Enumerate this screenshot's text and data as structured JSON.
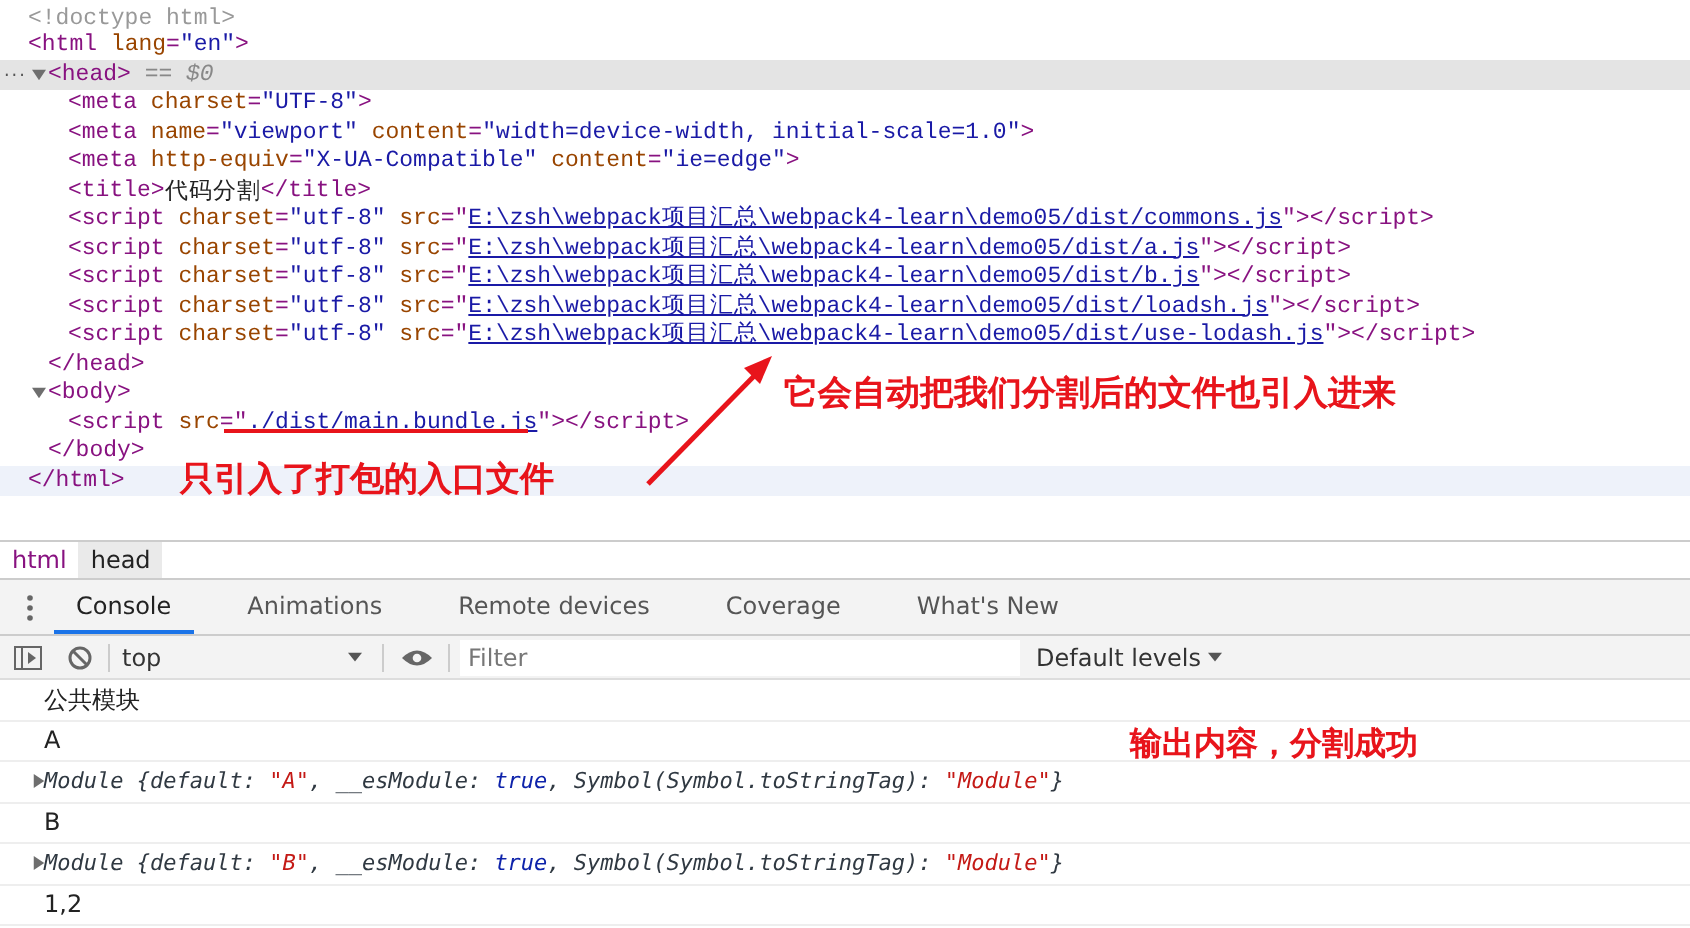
{
  "elements": {
    "doctype": "<!doctype html>",
    "rows": [
      {
        "selected": false,
        "hovered": false,
        "tokens": [
          {
            "kind": "tag",
            "text": "<html"
          },
          {
            "kind": "attr",
            "text": " lang"
          },
          {
            "kind": "tag",
            "text": "="
          },
          {
            "kind": "value",
            "text": "\"en\""
          },
          {
            "kind": "tag",
            "text": ">"
          }
        ],
        "children": [
          {
            "selected": true,
            "hovered": false,
            "expanded": true,
            "gutter": "...",
            "tokens": [
              {
                "kind": "tag",
                "text": "<head>"
              },
              {
                "kind": "marker",
                "text": " == $0"
              }
            ],
            "children": [
              {
                "selected": false,
                "hovered": false,
                "tokens": [
                  {
                    "kind": "tag",
                    "text": "<meta"
                  },
                  {
                    "kind": "attr",
                    "text": " charset"
                  },
                  {
                    "kind": "tag",
                    "text": "="
                  },
                  {
                    "kind": "value",
                    "text": "\"UTF-8\""
                  },
                  {
                    "kind": "tag",
                    "text": ">"
                  }
                ]
              },
              {
                "selected": false,
                "hovered": false,
                "tokens": [
                  {
                    "kind": "tag",
                    "text": "<meta"
                  },
                  {
                    "kind": "attr",
                    "text": " name"
                  },
                  {
                    "kind": "tag",
                    "text": "="
                  },
                  {
                    "kind": "value",
                    "text": "\"viewport\""
                  },
                  {
                    "kind": "attr",
                    "text": " content"
                  },
                  {
                    "kind": "tag",
                    "text": "="
                  },
                  {
                    "kind": "value",
                    "text": "\"width=device-width, initial-scale=1.0\""
                  },
                  {
                    "kind": "tag",
                    "text": ">"
                  }
                ]
              },
              {
                "selected": false,
                "hovered": false,
                "tokens": [
                  {
                    "kind": "tag",
                    "text": "<meta"
                  },
                  {
                    "kind": "attr",
                    "text": " http-equiv"
                  },
                  {
                    "kind": "tag",
                    "text": "="
                  },
                  {
                    "kind": "value",
                    "text": "\"X-UA-Compatible\""
                  },
                  {
                    "kind": "attr",
                    "text": " content"
                  },
                  {
                    "kind": "tag",
                    "text": "="
                  },
                  {
                    "kind": "value",
                    "text": "\"ie=edge\""
                  },
                  {
                    "kind": "tag",
                    "text": ">"
                  }
                ]
              },
              {
                "selected": false,
                "hovered": false,
                "tokens": [
                  {
                    "kind": "tag",
                    "text": "<title>"
                  },
                  {
                    "kind": "text",
                    "text": "代码分割"
                  },
                  {
                    "kind": "tag",
                    "text": "</title>"
                  }
                ]
              },
              {
                "selected": false,
                "hovered": false,
                "tokens": [
                  {
                    "kind": "tag",
                    "text": "<script"
                  },
                  {
                    "kind": "attr",
                    "text": " charset"
                  },
                  {
                    "kind": "tag",
                    "text": "="
                  },
                  {
                    "kind": "value",
                    "text": "\"utf-8\""
                  },
                  {
                    "kind": "attr",
                    "text": " src"
                  },
                  {
                    "kind": "tag",
                    "text": "=\""
                  },
                  {
                    "kind": "link",
                    "text": "E:\\zsh\\webpack项目汇总\\webpack4-learn\\demo05/dist/commons.js"
                  },
                  {
                    "kind": "tag",
                    "text": "\"></script>"
                  }
                ]
              },
              {
                "selected": false,
                "hovered": false,
                "tokens": [
                  {
                    "kind": "tag",
                    "text": "<script"
                  },
                  {
                    "kind": "attr",
                    "text": " charset"
                  },
                  {
                    "kind": "tag",
                    "text": "="
                  },
                  {
                    "kind": "value",
                    "text": "\"utf-8\""
                  },
                  {
                    "kind": "attr",
                    "text": " src"
                  },
                  {
                    "kind": "tag",
                    "text": "=\""
                  },
                  {
                    "kind": "link",
                    "text": "E:\\zsh\\webpack项目汇总\\webpack4-learn\\demo05/dist/a.js"
                  },
                  {
                    "kind": "tag",
                    "text": "\"></script>"
                  }
                ]
              },
              {
                "selected": false,
                "hovered": false,
                "tokens": [
                  {
                    "kind": "tag",
                    "text": "<script"
                  },
                  {
                    "kind": "attr",
                    "text": " charset"
                  },
                  {
                    "kind": "tag",
                    "text": "="
                  },
                  {
                    "kind": "value",
                    "text": "\"utf-8\""
                  },
                  {
                    "kind": "attr",
                    "text": " src"
                  },
                  {
                    "kind": "tag",
                    "text": "=\""
                  },
                  {
                    "kind": "link",
                    "text": "E:\\zsh\\webpack项目汇总\\webpack4-learn\\demo05/dist/b.js"
                  },
                  {
                    "kind": "tag",
                    "text": "\"></script>"
                  }
                ]
              },
              {
                "selected": false,
                "hovered": false,
                "tokens": [
                  {
                    "kind": "tag",
                    "text": "<script"
                  },
                  {
                    "kind": "attr",
                    "text": " charset"
                  },
                  {
                    "kind": "tag",
                    "text": "="
                  },
                  {
                    "kind": "value",
                    "text": "\"utf-8\""
                  },
                  {
                    "kind": "attr",
                    "text": " src"
                  },
                  {
                    "kind": "tag",
                    "text": "=\""
                  },
                  {
                    "kind": "link",
                    "text": "E:\\zsh\\webpack项目汇总\\webpack4-learn\\demo05/dist/loadsh.js"
                  },
                  {
                    "kind": "tag",
                    "text": "\"></script>"
                  }
                ]
              },
              {
                "selected": false,
                "hovered": false,
                "tokens": [
                  {
                    "kind": "tag",
                    "text": "<script"
                  },
                  {
                    "kind": "attr",
                    "text": " charset"
                  },
                  {
                    "kind": "tag",
                    "text": "="
                  },
                  {
                    "kind": "value",
                    "text": "\"utf-8\""
                  },
                  {
                    "kind": "attr",
                    "text": " src"
                  },
                  {
                    "kind": "tag",
                    "text": "=\""
                  },
                  {
                    "kind": "link",
                    "text": "E:\\zsh\\webpack项目汇总\\webpack4-learn\\demo05/dist/use-lodash.js"
                  },
                  {
                    "kind": "tag",
                    "text": "\"></script>"
                  }
                ]
              }
            ]
          },
          {
            "selected": false,
            "hovered": false,
            "tokens": [
              {
                "kind": "tag",
                "text": "</head>"
              }
            ]
          },
          {
            "selected": false,
            "hovered": false,
            "expanded": true,
            "tokens": [
              {
                "kind": "tag",
                "text": "<body>"
              }
            ],
            "children": [
              {
                "selected": false,
                "hovered": false,
                "tokens": [
                  {
                    "kind": "tag",
                    "text": "<script"
                  },
                  {
                    "kind": "attr",
                    "text": " src"
                  },
                  {
                    "kind": "tag",
                    "text": "=\""
                  },
                  {
                    "kind": "link",
                    "text": "./dist/main.bundle.js"
                  },
                  {
                    "kind": "tag",
                    "text": "\"></script>"
                  }
                ]
              }
            ]
          },
          {
            "selected": false,
            "hovered": false,
            "tokens": [
              {
                "kind": "tag",
                "text": "</body>"
              }
            ]
          }
        ]
      },
      {
        "selected": false,
        "hovered": true,
        "tokens": [
          {
            "kind": "tag",
            "text": "</html>"
          }
        ]
      }
    ]
  },
  "breadcrumbs": [
    {
      "label": "html",
      "selected": false
    },
    {
      "label": "head",
      "selected": true
    }
  ],
  "drawer_tabs": [
    {
      "label": "Console",
      "selected": true
    },
    {
      "label": "Animations",
      "selected": false
    },
    {
      "label": "Remote devices",
      "selected": false
    },
    {
      "label": "Coverage",
      "selected": false
    },
    {
      "label": "What's New",
      "selected": false
    }
  ],
  "console_toolbar": {
    "context": "top",
    "filter_placeholder": "Filter",
    "levels": "Default levels"
  },
  "console_messages": [
    {
      "kind": "text",
      "text": "公共模块"
    },
    {
      "kind": "text",
      "text": "A"
    },
    {
      "kind": "object",
      "expanded": false,
      "tokens": [
        {
          "kind": "plain",
          "text": "Module {default: "
        },
        {
          "kind": "string",
          "text": "\"A\""
        },
        {
          "kind": "plain",
          "text": ", __esModule: "
        },
        {
          "kind": "keyword",
          "text": "true"
        },
        {
          "kind": "plain",
          "text": ", Symbol(Symbol.toStringTag): "
        },
        {
          "kind": "string",
          "text": "\"Module\""
        },
        {
          "kind": "plain",
          "text": "}"
        }
      ]
    },
    {
      "kind": "text",
      "text": "B"
    },
    {
      "kind": "object",
      "expanded": false,
      "tokens": [
        {
          "kind": "plain",
          "text": "Module {default: "
        },
        {
          "kind": "string",
          "text": "\"B\""
        },
        {
          "kind": "plain",
          "text": ", __esModule: "
        },
        {
          "kind": "keyword",
          "text": "true"
        },
        {
          "kind": "plain",
          "text": ", Symbol(Symbol.toStringTag): "
        },
        {
          "kind": "string",
          "text": "\"Module\""
        },
        {
          "kind": "plain",
          "text": "}"
        }
      ]
    },
    {
      "kind": "text",
      "text": "1,2"
    }
  ],
  "annotations": {
    "auto_import_note": "它会自动把我们分割后的文件也引入进来",
    "entry_only_note": "只引入了打包的入口文件",
    "output_note": "输出内容，分割成功"
  }
}
